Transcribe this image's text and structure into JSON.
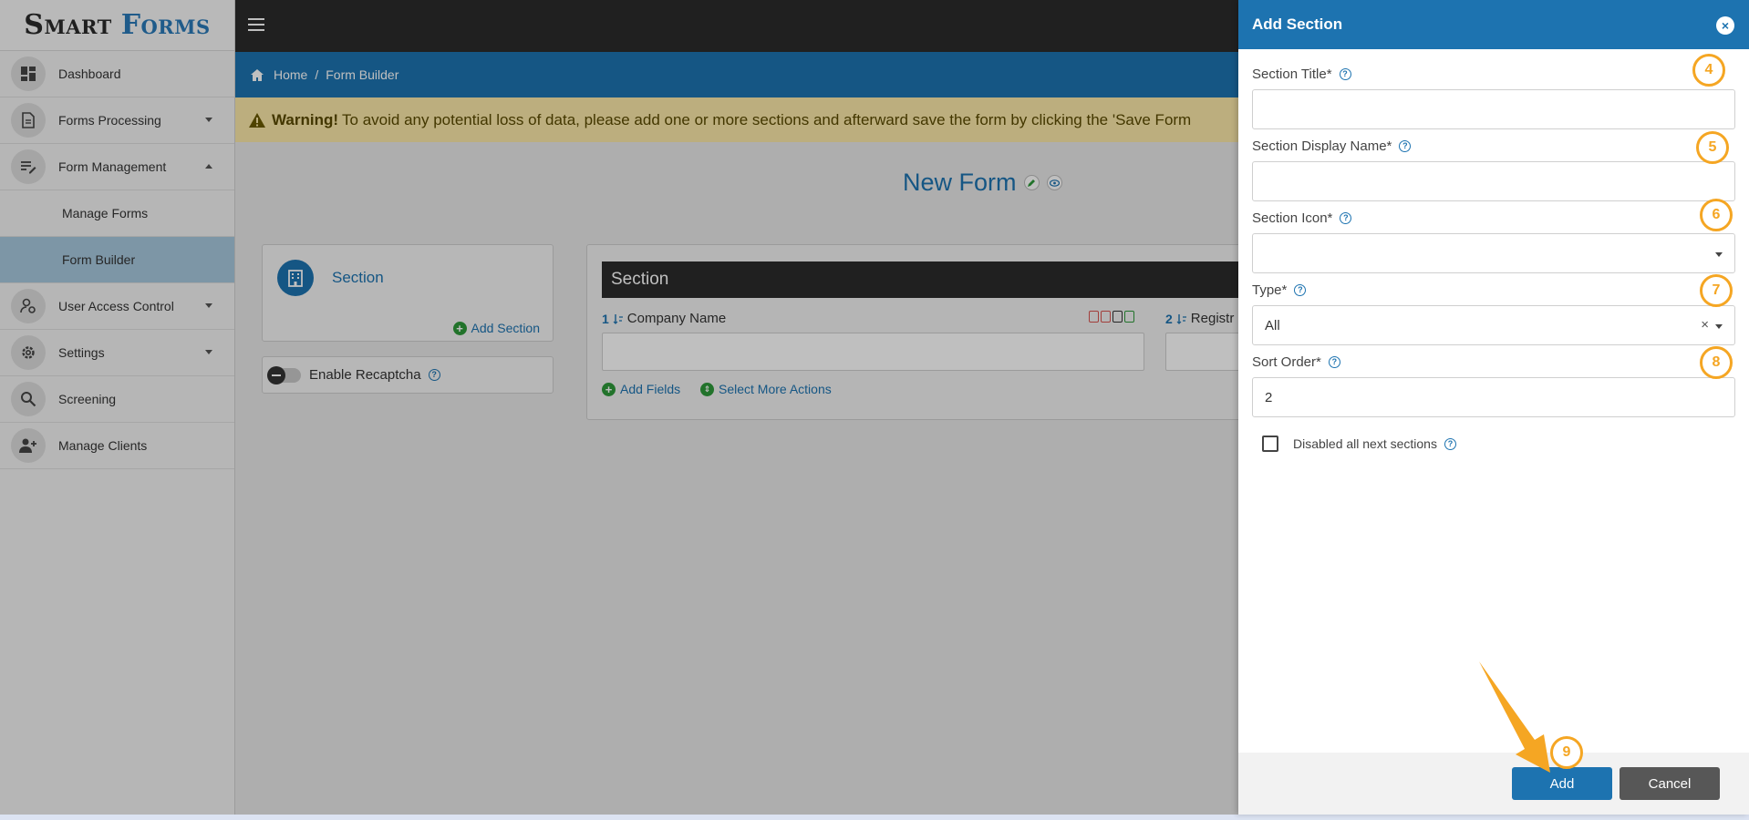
{
  "app": {
    "logo_part1": "Smart",
    "logo_part2": "Forms"
  },
  "sidebar": {
    "items": [
      {
        "label": "Dashboard",
        "icon": "dashboard-icon"
      },
      {
        "label": "Forms Processing",
        "icon": "document-icon",
        "expandable": true
      },
      {
        "label": "Form Management",
        "icon": "edit-list-icon",
        "expanded": true
      },
      {
        "label": "Manage Forms",
        "sub": true
      },
      {
        "label": "Form Builder",
        "sub": true,
        "active": true
      },
      {
        "label": "User Access Control",
        "icon": "user-settings-icon",
        "expandable": true
      },
      {
        "label": "Settings",
        "icon": "gear-icon",
        "expandable": true
      },
      {
        "label": "Screening",
        "icon": "search-icon"
      },
      {
        "label": "Manage Clients",
        "icon": "add-user-icon"
      }
    ]
  },
  "breadcrumb": {
    "home": "Home",
    "sep": "/",
    "current": "Form Builder"
  },
  "warning": {
    "label": "Warning!",
    "text": "To avoid any potential loss of data, please add one or more sections and afterward save the form by clicking the 'Save Form"
  },
  "main": {
    "form_title": "New Form",
    "section_card": {
      "title": "Section",
      "add_link": "Add Section"
    },
    "recaptcha_label": "Enable Recaptcha",
    "builder": {
      "header": "Section",
      "field1": {
        "num": "1",
        "label": "Company Name"
      },
      "field2": {
        "num": "2",
        "label": "Registr"
      },
      "add_fields": "Add Fields",
      "more_actions": "Select More Actions"
    }
  },
  "drawer": {
    "title": "Add Section",
    "close_icon": "×",
    "section_title_label": "Section Title*",
    "section_display_name_label": "Section Display Name*",
    "section_icon_label": "Section Icon*",
    "type_label": "Type*",
    "type_value": "All",
    "clear_glyph": "×",
    "sort_order_label": "Sort Order*",
    "sort_order_value": "2",
    "disabled_next_label": "Disabled all next sections",
    "add_button": "Add",
    "cancel_button": "Cancel",
    "help_glyph": "?"
  },
  "annotations": {
    "b4": "4",
    "b5": "5",
    "b6": "6",
    "b7": "7",
    "b8": "8",
    "b9": "9"
  },
  "colors": {
    "primary": "#1d73b0",
    "topbar": "#2b2b2b",
    "warning_bg": "#fbe9a8",
    "annotation": "#f5a623",
    "success": "#2e9a3a"
  }
}
